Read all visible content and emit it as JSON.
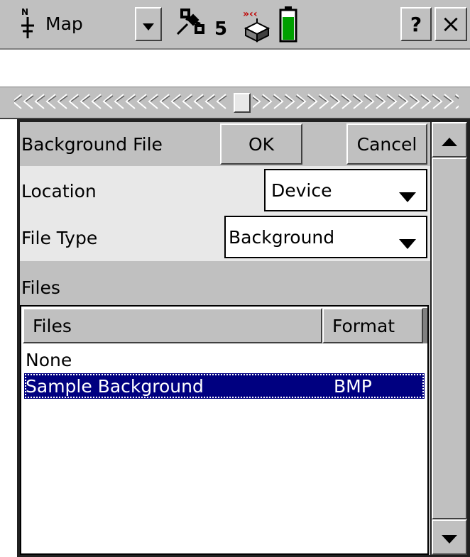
{
  "title_bar": {
    "app_name": "Map",
    "north_label": "N",
    "satellite_count": "5",
    "help_label": "?",
    "close_label": "×"
  },
  "form": {
    "heading": "Background File",
    "ok_label": "OK",
    "cancel_label": "Cancel",
    "location_label": "Location",
    "location_value": "Device",
    "file_type_label": "File Type",
    "file_type_value": "Background",
    "files_section_label": "Files"
  },
  "file_list": {
    "columns": [
      "Files",
      "Format"
    ],
    "rows": [
      {
        "name": "None",
        "format": ""
      },
      {
        "name": "Sample Background",
        "format": "BMP"
      }
    ],
    "selected_row": 1
  },
  "colors": {
    "panel_gray": "#c0c0c0",
    "dark_frame": "#202020",
    "selection_navy": "#000080",
    "battery_green": "#00a000",
    "signal_red": "#c00000"
  }
}
